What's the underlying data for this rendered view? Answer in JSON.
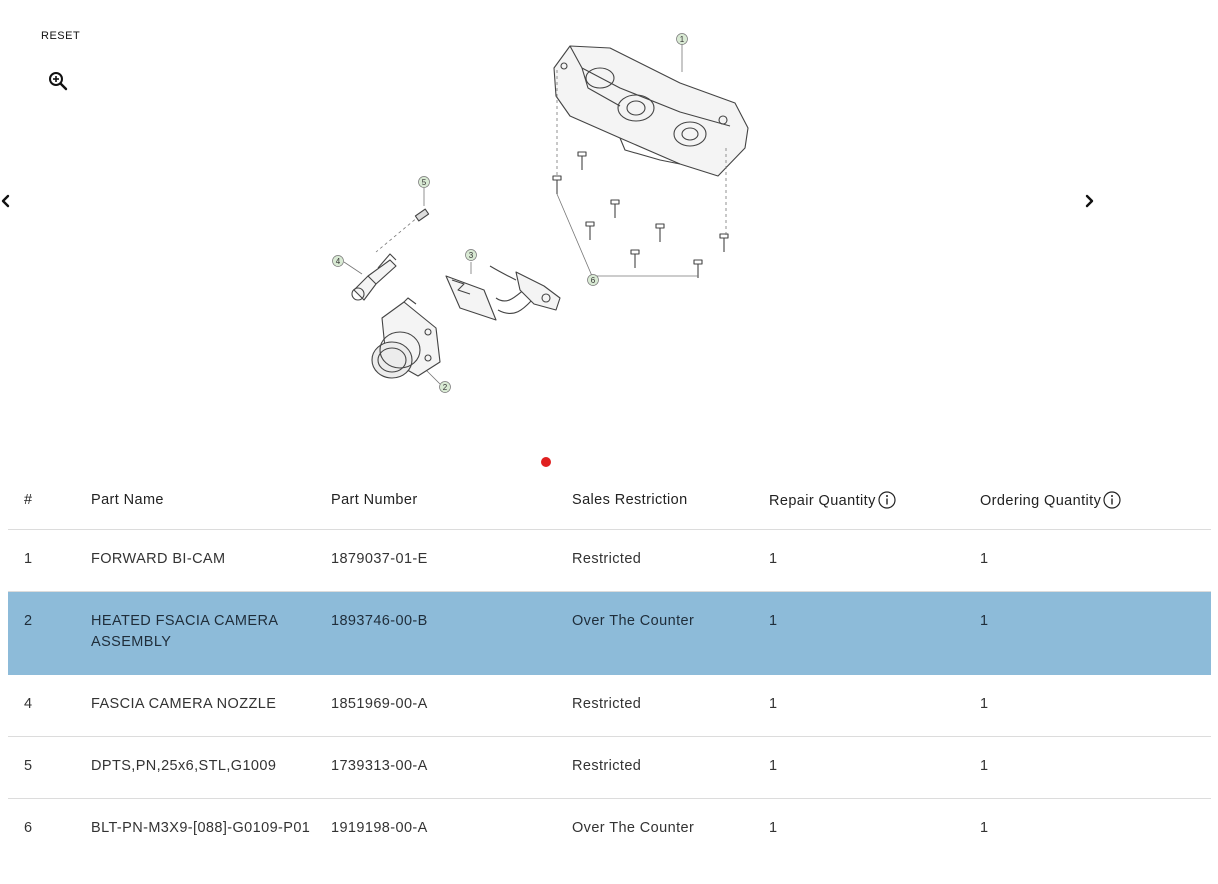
{
  "controls": {
    "reset_label": "RESET",
    "zoom_icon": "zoom-in-icon",
    "prev_icon": "chevron-left-icon",
    "next_icon": "chevron-right-icon"
  },
  "diagram": {
    "callouts": [
      "1",
      "2",
      "3",
      "4",
      "5",
      "6"
    ]
  },
  "carousel": {
    "active_dot_color": "#e02020"
  },
  "table": {
    "headers": {
      "num": "#",
      "part_name": "Part Name",
      "part_number": "Part Number",
      "sales_restriction": "Sales Restriction",
      "repair_quantity": "Repair Quantity",
      "ordering_quantity": "Ordering Quantity"
    },
    "selected_row_color": "#8dbbd9",
    "rows": [
      {
        "num": "1",
        "part_name": "FORWARD BI-CAM",
        "part_number": "1879037-01-E",
        "sales_restriction": "Restricted",
        "repair_quantity": "1",
        "ordering_quantity": "1"
      },
      {
        "num": "2",
        "part_name": "HEATED FSACIA CAMERA ASSEMBLY",
        "part_number": "1893746-00-B",
        "sales_restriction": "Over The Counter",
        "repair_quantity": "1",
        "ordering_quantity": "1"
      },
      {
        "num": "4",
        "part_name": "FASCIA CAMERA NOZZLE",
        "part_number": "1851969-00-A",
        "sales_restriction": "Restricted",
        "repair_quantity": "1",
        "ordering_quantity": "1"
      },
      {
        "num": "5",
        "part_name": "DPTS,PN,25x6,STL,G1009",
        "part_number": "1739313-00-A",
        "sales_restriction": "Restricted",
        "repair_quantity": "1",
        "ordering_quantity": "1"
      },
      {
        "num": "6",
        "part_name": "BLT-PN-M3X9-[088]-G0109-P01",
        "part_number": "1919198-00-A",
        "sales_restriction": "Over The Counter",
        "repair_quantity": "1",
        "ordering_quantity": "1"
      }
    ]
  }
}
